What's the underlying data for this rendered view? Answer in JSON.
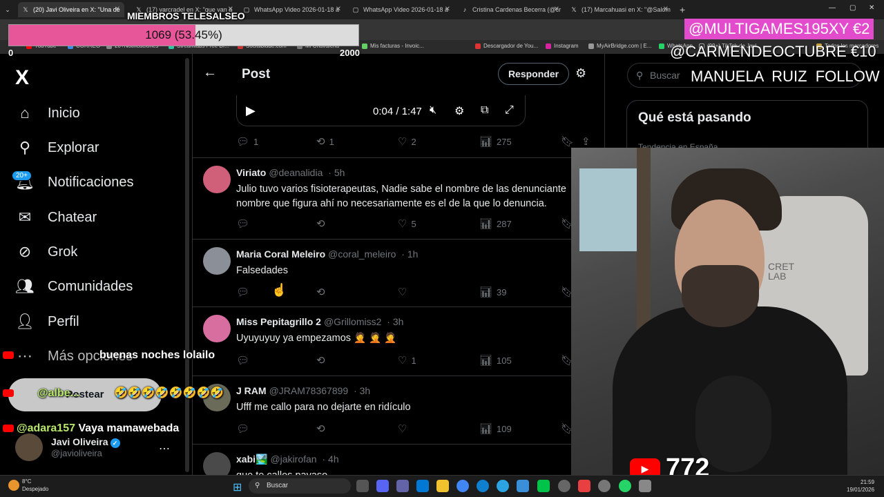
{
  "browser": {
    "tabs": [
      {
        "title": "(20) Javi Oliveira en X: \"Una de",
        "icon": "X"
      },
      {
        "title": "(17) varcradel en X: \"que van a",
        "icon": "X"
      },
      {
        "title": "WhatsApp Video 2026-01-18 a",
        "icon": "◻"
      },
      {
        "title": "WhatsApp Video 2026-01-18 a",
        "icon": "◻"
      },
      {
        "title": "Cristina Cardenas Becerra (@cr",
        "icon": "♪"
      },
      {
        "title": "(17) Marcahuasi en X: \"@Salom",
        "icon": "X"
      }
    ],
    "new_tab": "+",
    "bookmarks": [
      "YouTube",
      "CORREO",
      "20+Notificaciones",
      "Streamlabs Free Dr...",
      "Socialblade.com",
      "Mi Chavaleria",
      "Mis facturas - Invoic...",
      "Descargador de You...",
      "Instagram",
      "MyAirBridge.com | E...",
      "WhatsApp",
      "(99+) TikTok de Javi...",
      "Todos los marcadores"
    ]
  },
  "overlay": {
    "members_title": "MIEMBROS TELESALSEO",
    "progress_label": "1069 (53.45%)",
    "progress_fraction": 0.5345,
    "progress_min": "0",
    "progress_max": "2000",
    "donor1": "@MULTIGAMES195XY  €2",
    "donor2": "@CARMENDEOCTUBRE  €10",
    "follow": "MANUELA RUIZ  FOLLOW",
    "viewers": "772",
    "accent": "#e8569a"
  },
  "sidebar": {
    "logo": "X",
    "items": [
      {
        "label": "Inicio",
        "icon": "home-icon"
      },
      {
        "label": "Explorar",
        "icon": "search-icon"
      },
      {
        "label": "Notificaciones",
        "icon": "bell-icon",
        "badge": "20+"
      },
      {
        "label": "Chatear",
        "icon": "mail-icon"
      },
      {
        "label": "Grok",
        "icon": "grok-icon"
      },
      {
        "label": "Comunidades",
        "icon": "people-icon"
      },
      {
        "label": "Perfil",
        "icon": "person-icon"
      },
      {
        "label": "Más opciones",
        "icon": "more-icon"
      }
    ],
    "post_button": "Postear",
    "account": {
      "name": "Javi Oliveira",
      "handle": "@javioliveira"
    }
  },
  "post": {
    "title": "Post",
    "reply_button": "Responder",
    "video": {
      "time": "0:04 / 1:47"
    },
    "main_stats": {
      "replies": "1",
      "reposts": "1",
      "likes": "2",
      "views": "275"
    }
  },
  "replies": [
    {
      "name": "Viriato",
      "handle": "@deanalidia",
      "time": "5h",
      "lines": [
        "Julio tuvo varios fisioterapeutas, Nadie sabe el nombre de las denunciante",
        "nombre que figura ahí no necesariamente es el de la que lo denuncia."
      ],
      "replies": "",
      "reposts": "",
      "likes": "5",
      "views": "287",
      "color": "#d0607a"
    },
    {
      "name": "Maria Coral Meleiro",
      "handle": "@coral_meleiro",
      "time": "1h",
      "lines": [
        "Falsedades"
      ],
      "replies": "",
      "reposts": "",
      "likes": "",
      "views": "39",
      "color": "#8a8f98"
    },
    {
      "name": "Miss Pepitagrillo 2",
      "handle": "@Grillomiss2",
      "time": "3h",
      "lines": [
        "Uyuyuyuy ya empezamos 🤦 🤦 🤦"
      ],
      "replies": "",
      "reposts": "",
      "likes": "1",
      "views": "105",
      "color": "#d86ea0"
    },
    {
      "name": "J RAM",
      "handle": "@JRAM78367899",
      "time": "3h",
      "lines": [
        "Ufff me callo para no dejarte en ridículo"
      ],
      "replies": "",
      "reposts": "",
      "likes": "",
      "views": "109",
      "color": "#6b6b5a"
    },
    {
      "name": "xabi🏞️",
      "handle": "@jakirofan",
      "time": "4h",
      "lines": [
        "que te calles payaso"
      ],
      "replies": "",
      "reposts": "",
      "likes": "",
      "views": "",
      "color": "#4a4a4a"
    }
  ],
  "right": {
    "search_placeholder": "Buscar",
    "trending_title": "Qué está pasando",
    "trending_sub": "Tendencia en España"
  },
  "chat": [
    {
      "user": "",
      "message": "buenas noches lolailo"
    },
    {
      "user": "@albe...",
      "message": "🤣🤣🤣🤣🤣🤣🤣🤣"
    },
    {
      "user": "@adara157",
      "message": "Vaya mamawebada"
    }
  ],
  "taskbar": {
    "weather_temp": "8°C",
    "weather_desc": "Despejado",
    "search": "Buscar",
    "time": "21:59",
    "date": "19/01/2026"
  }
}
